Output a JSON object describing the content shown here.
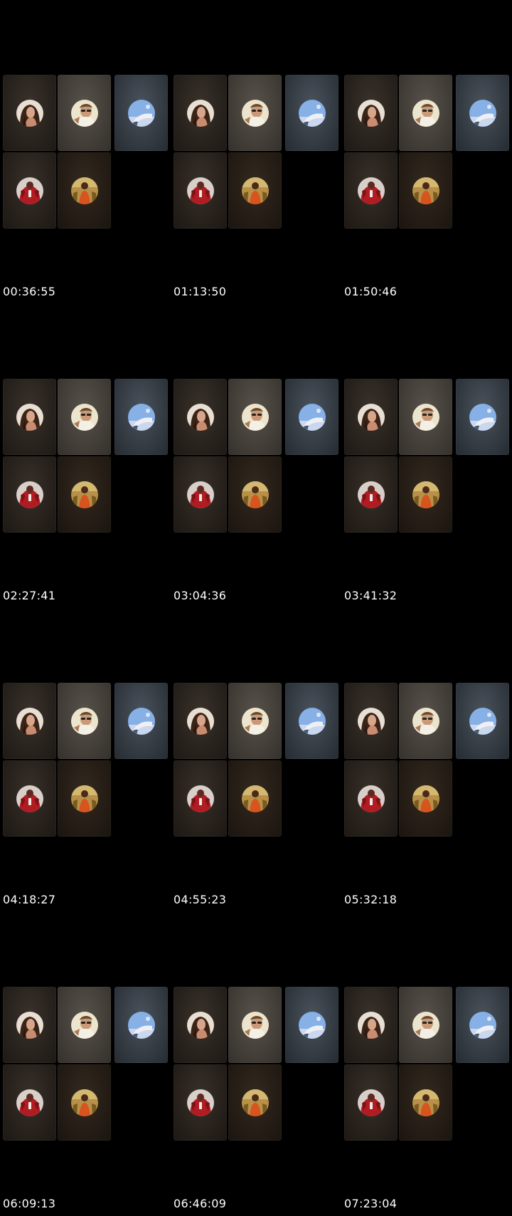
{
  "app": {
    "background": "#000000"
  },
  "thumbnails": [
    {
      "timestamp": "00:36:55"
    },
    {
      "timestamp": "01:13:50"
    },
    {
      "timestamp": "01:50:46"
    },
    {
      "timestamp": "02:27:41"
    },
    {
      "timestamp": "03:04:36"
    },
    {
      "timestamp": "03:41:32"
    },
    {
      "timestamp": "04:18:27"
    },
    {
      "timestamp": "04:55:23"
    },
    {
      "timestamp": "05:32:18"
    },
    {
      "timestamp": "06:09:13"
    },
    {
      "timestamp": "06:46:09"
    },
    {
      "timestamp": "07:23:04"
    }
  ],
  "participants": [
    {
      "icon": "participant-avatar-woman-dark-hair",
      "tile_color": "#2a241f",
      "avatar_color": "#e6ddd0"
    },
    {
      "icon": "participant-avatar-woman-sunglasses",
      "tile_color": "#45403a",
      "avatar_color": "#e8e0c8"
    },
    {
      "icon": "participant-avatar-sky-photo",
      "tile_color": "#363d45",
      "avatar_color": "#7fa8e0"
    },
    {
      "icon": "participant-avatar-red-outfit",
      "tile_color": "#29221d",
      "avatar_color": "#a81e22"
    },
    {
      "icon": "participant-avatar-orange-dress",
      "tile_color": "#261e16",
      "avatar_color": "#c8a040"
    }
  ]
}
